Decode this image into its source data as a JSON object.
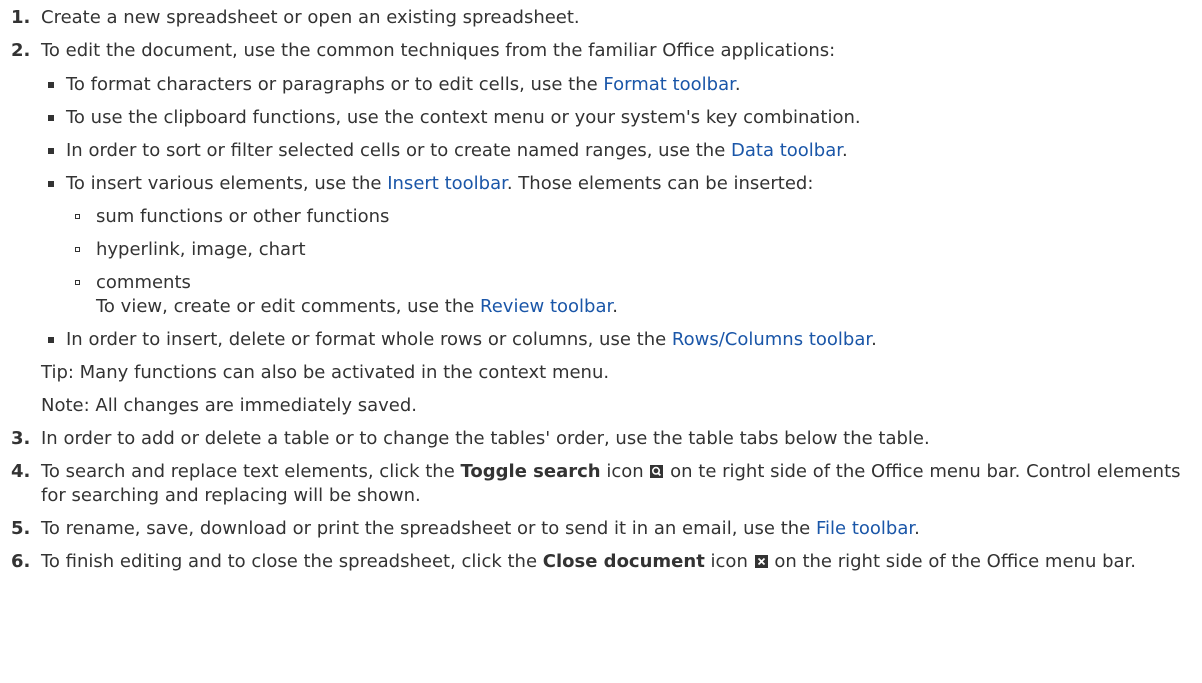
{
  "steps": {
    "s1": {
      "num": "1.",
      "text": "Create a new spreadsheet or open an existing spreadsheet."
    },
    "s2": {
      "num": "2.",
      "text": "To edit the document, use the common techniques from the familiar Office applications:",
      "b1": {
        "pre": "To format characters or paragraphs or to edit cells, use the ",
        "link": "Format toolbar",
        "post": "."
      },
      "b2": {
        "text": "To use the clipboard functions, use the context menu or your system's key combination."
      },
      "b3": {
        "pre": "In order to sort or filter selected cells or to create named ranges, use the ",
        "link": "Data toolbar",
        "post": "."
      },
      "b4": {
        "pre": "To insert various elements, use the ",
        "link": "Insert toolbar",
        "post": ". Those elements can be inserted:",
        "sub": [
          "sum functions or other functions",
          "hyperlink, image, chart",
          "comments"
        ],
        "note_pre": "To view, create or edit comments, use the ",
        "note_link": "Review toolbar",
        "note_post": "."
      },
      "b5": {
        "pre": "In order to insert, delete or format whole rows or columns, use the ",
        "link": "Rows/Columns toolbar",
        "post": "."
      },
      "tip": "Tip: Many functions can also be activated in the context menu.",
      "note": "Note: All changes are immediately saved."
    },
    "s3": {
      "num": "3.",
      "text": "In order to add or delete a table or to change the tables' order, use the table tabs below the table."
    },
    "s4": {
      "num": "4.",
      "pre": "To search and replace text elements, click the ",
      "bold": "Toggle search",
      "mid": " icon",
      "post": " on te right side of the Office menu bar. Control elements for searching and replacing will be shown.",
      "icon": "search-icon"
    },
    "s5": {
      "num": "5.",
      "pre": "To rename, save, download or print the spreadsheet or to send it in an email, use the ",
      "link": "File toolbar",
      "post": "."
    },
    "s6": {
      "num": "6.",
      "pre": "To finish editing and to close the spreadsheet, click the ",
      "bold": "Close document",
      "mid": " icon",
      "post": " on the right side of the Office menu bar.",
      "icon": "close-icon"
    }
  },
  "colors": {
    "text": "#333333",
    "link": "#1a56a8",
    "background": "#ffffff"
  }
}
